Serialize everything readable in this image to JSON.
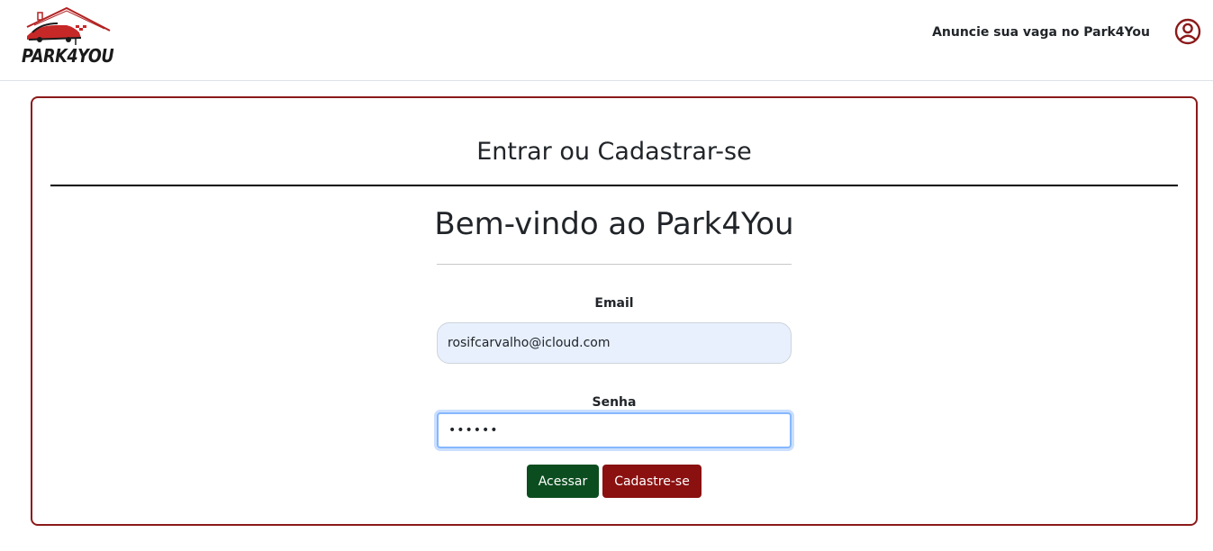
{
  "brand": {
    "logo_text": "PARK4YOU",
    "colors": {
      "primary": "#8b1a1a",
      "success": "#0b4d1f",
      "danger": "#8b1010"
    }
  },
  "nav": {
    "link_label": "Anuncie sua vaga no Park4You",
    "user_icon": "user-circle-icon"
  },
  "card": {
    "title": "Entrar ou Cadastrar-se",
    "welcome": "Bem-vindo ao Park4You"
  },
  "form": {
    "email_label": "Email",
    "email_value": "rosifcarvalho@icloud.com",
    "senha_label": "Senha",
    "senha_value": "••••••",
    "acessar_label": "Acessar",
    "cadastre_label": "Cadastre-se"
  }
}
